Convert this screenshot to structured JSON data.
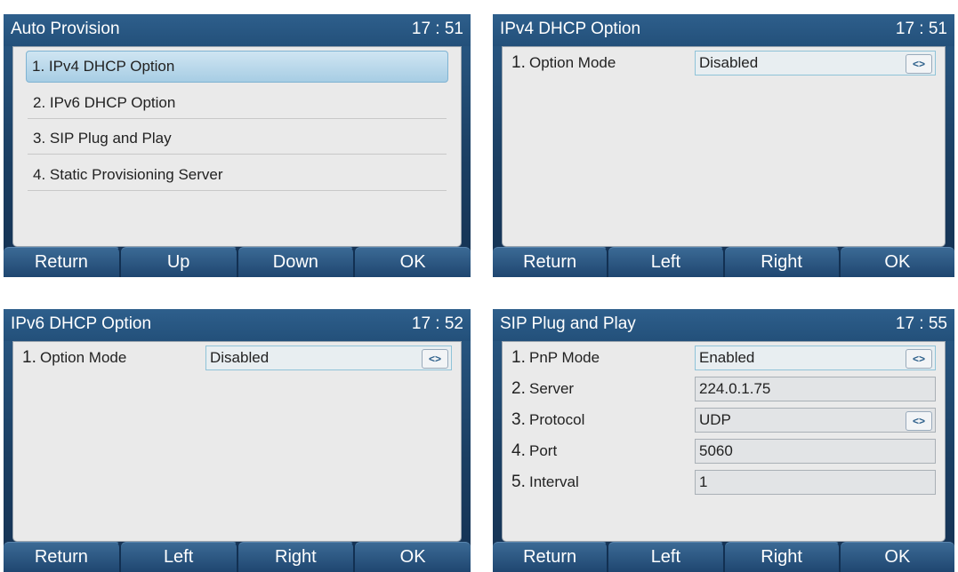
{
  "screens": [
    {
      "title": "Auto Provision",
      "clock": "17 : 51",
      "menu": [
        {
          "label": "1. IPv4 DHCP Option"
        },
        {
          "label": "2. IPv6 DHCP Option"
        },
        {
          "label": "3. SIP Plug and Play"
        },
        {
          "label": "4. Static Provisioning Server"
        }
      ],
      "softkeys": [
        "Return",
        "Up",
        "Down",
        "OK"
      ]
    },
    {
      "title": "IPv4 DHCP Option",
      "clock": "17 : 51",
      "rows": [
        {
          "num": "1.",
          "label": "Option Mode",
          "value": "Disabled",
          "selector": "<>"
        }
      ],
      "softkeys": [
        "Return",
        "Left",
        "Right",
        "OK"
      ]
    },
    {
      "title": "IPv6 DHCP Option",
      "clock": "17 : 52",
      "rows": [
        {
          "num": "1.",
          "label": "Option Mode",
          "value": "Disabled",
          "selector": "<>"
        }
      ],
      "softkeys": [
        "Return",
        "Left",
        "Right",
        "OK"
      ]
    },
    {
      "title": "SIP Plug and Play",
      "clock": "17 : 55",
      "rows": [
        {
          "num": "1.",
          "label": "PnP Mode",
          "value": "Enabled",
          "selector": "<>"
        },
        {
          "num": "2.",
          "label": "Server",
          "value": "224.0.1.75"
        },
        {
          "num": "3.",
          "label": "Protocol",
          "value": "UDP",
          "selector": "<>"
        },
        {
          "num": "4.",
          "label": "Port",
          "value": "5060"
        },
        {
          "num": "5.",
          "label": "Interval",
          "value": "1"
        }
      ],
      "softkeys": [
        "Return",
        "Left",
        "Right",
        "OK"
      ]
    }
  ]
}
